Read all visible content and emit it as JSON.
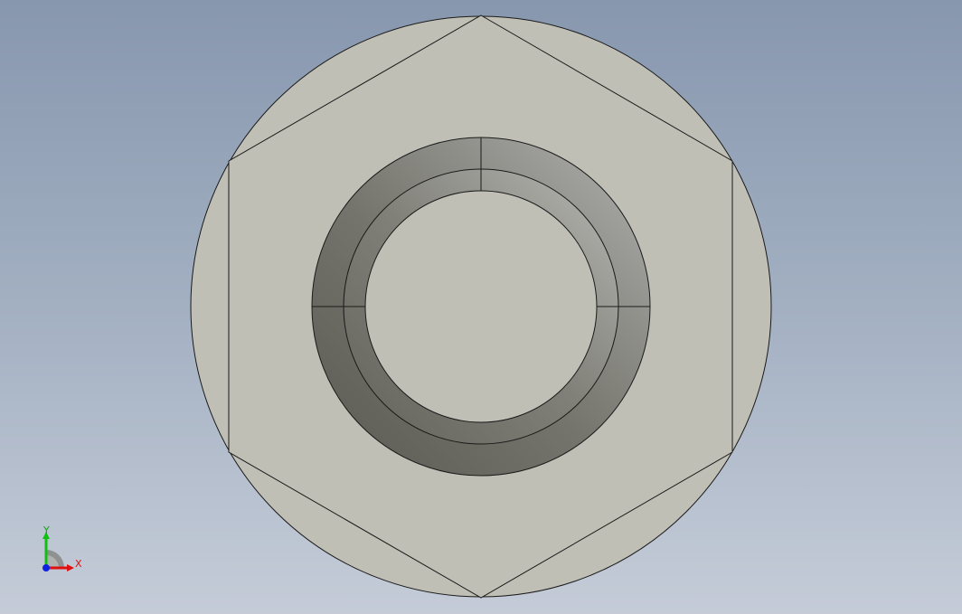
{
  "view": {
    "background_top": "#8797ae",
    "background_bottom": "#c5ccd8"
  },
  "model": {
    "part": "hex flange nut",
    "view_orientation": "front",
    "face_color": "#c0bfb6",
    "edge_color": "#1a1a1a",
    "thread_shade_dark": "#5f5f58",
    "thread_shade_light": "#a8a8a4"
  },
  "triad": {
    "x_label": "X",
    "y_label": "Y",
    "x_color": "#e01010",
    "y_color": "#10c010",
    "z_color": "#1020e0"
  }
}
